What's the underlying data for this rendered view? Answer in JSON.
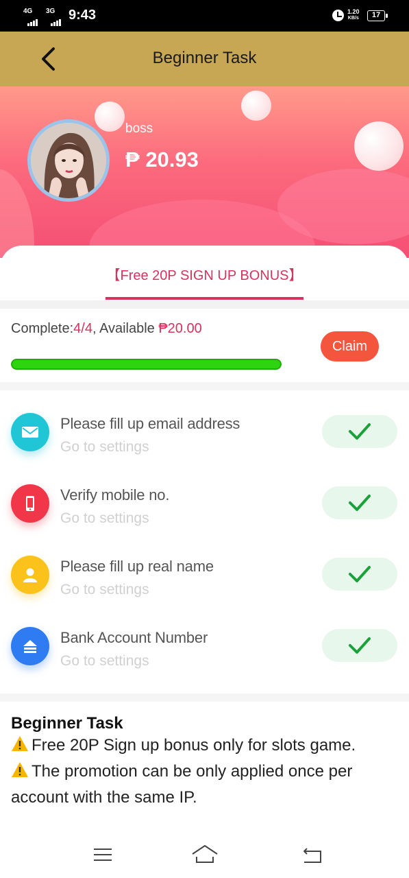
{
  "status_bar": {
    "network_1": "4G",
    "network_2": "3G",
    "time": "9:43",
    "speed_value": "1.20",
    "speed_unit": "KB/s",
    "battery": "17"
  },
  "nav": {
    "title": "Beginner Task"
  },
  "profile": {
    "username": "boss",
    "currency_symbol": "₱",
    "balance": "20.93"
  },
  "tab": {
    "label": "【Free 20P SIGN UP BONUS】"
  },
  "progress": {
    "complete_label": "Complete:",
    "complete_value": "4/4",
    "available_label": ", Available ",
    "available_value": "₱20.00",
    "fraction": 1.0,
    "claim_label": "Claim"
  },
  "tasks": [
    {
      "title": "Please fill up email address",
      "subtitle": "Go to settings",
      "icon": "email-icon",
      "color": "#21c6d6",
      "done": true
    },
    {
      "title": "Verify mobile no.",
      "subtitle": "Go to settings",
      "icon": "mobile-phone-icon",
      "color": "#f2364a",
      "done": true
    },
    {
      "title": "Please fill up real name",
      "subtitle": "Go to settings",
      "icon": "user-icon",
      "color": "#fbc21b",
      "done": true
    },
    {
      "title": "Bank Account Number",
      "subtitle": "Go to settings",
      "icon": "bank-card-icon",
      "color": "#2f7cf2",
      "done": true
    }
  ],
  "notes": {
    "title": "Beginner Task",
    "line1": "Free 20P Sign up bonus only for slots game.",
    "line2": "The promotion can be only applied once per",
    "line3": "account with the same IP."
  },
  "colors": {
    "nav_bg": "#c7a654",
    "accent": "#d6335e",
    "claim": "#f4553d",
    "progress": "#2ed40f",
    "check": "#1aa13a"
  }
}
